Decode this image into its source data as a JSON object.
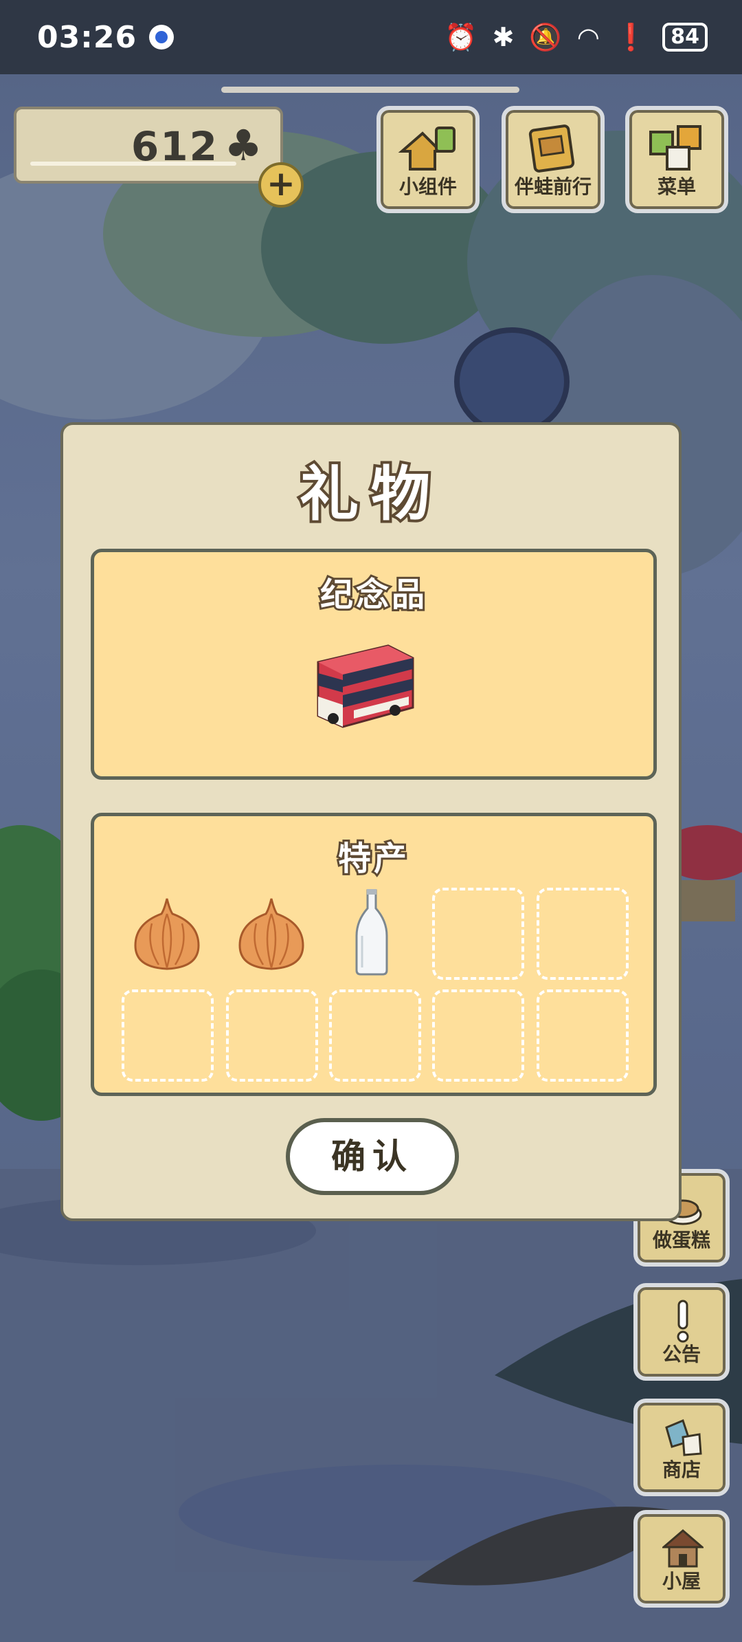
{
  "status_bar": {
    "time": "03:26",
    "battery": "84"
  },
  "counter": {
    "value": "612",
    "currency_icon": "clover-icon",
    "add_icon": "plus-icon"
  },
  "top_buttons": [
    {
      "label": "小组件",
      "icon": "widget-icon"
    },
    {
      "label": "伴蛙前行",
      "icon": "journal-icon"
    },
    {
      "label": "菜单",
      "icon": "menu-icon"
    }
  ],
  "side_buttons": [
    {
      "label": "做蛋糕",
      "icon": "cake-icon"
    },
    {
      "label": "公告",
      "icon": "notice-icon"
    },
    {
      "label": "商店",
      "icon": "shop-icon"
    },
    {
      "label": "小屋",
      "icon": "house-icon"
    }
  ],
  "dialog": {
    "title": "礼物",
    "souvenir": {
      "title": "纪念品",
      "item_icon": "double-decker-bus-icon"
    },
    "specialty": {
      "title": "特产",
      "items": [
        "onion-icon",
        "onion-icon",
        "glass-bottle-icon"
      ],
      "empty_slots": 7
    },
    "confirm_label": "确认"
  },
  "colors": {
    "dialog_bg": "#e8dfc2",
    "panel_bg": "#fedf9b",
    "status_bg": "#2f3745"
  }
}
